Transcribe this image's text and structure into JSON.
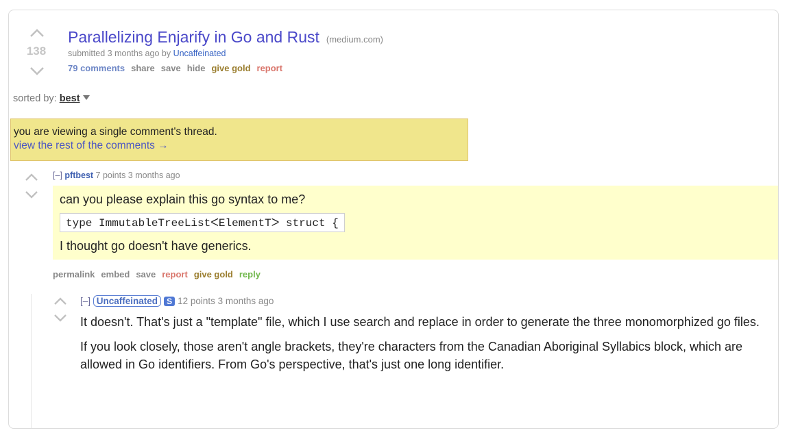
{
  "post": {
    "score": "138",
    "title": "Parallelizing Enjarify in Go and Rust",
    "domain": "(medium.com)",
    "tagline_prefix": "submitted 3 months ago by",
    "author": "Uncaffeinated",
    "buttons": {
      "comments": "79 comments",
      "share": "share",
      "save": "save",
      "hide": "hide",
      "give_gold": "give gold",
      "report": "report"
    }
  },
  "sort": {
    "label": "sorted by:",
    "value": "best"
  },
  "infobar": {
    "line1": "you are viewing a single comment's thread.",
    "line2": "view the rest of the comments →"
  },
  "comment1": {
    "expand": "[–]",
    "author": "pftbest",
    "meta": "7 points 3 months ago",
    "para1": "can you please explain this go syntax to me?",
    "code": "type ImmutableTreeListᐸElementTᐳ struct {",
    "para2": "I thought go doesn't have generics.",
    "buttons": {
      "permalink": "permalink",
      "embed": "embed",
      "save": "save",
      "report": "report",
      "give_gold": "give gold",
      "reply": "reply"
    }
  },
  "comment2": {
    "expand": "[–]",
    "author": "Uncaffeinated",
    "submitter_badge": "S",
    "meta": "12 points 3 months ago",
    "para1": "It doesn't. That's just a \"template\" file, which I use search and replace in order to generate the three monomorphized go files.",
    "para2": "If you look closely, those aren't angle brackets, they're characters from the Canadian Aboriginal Syllabics block, which are allowed in Go identifiers. From Go's perspective, that's just one long identifier."
  },
  "colors": {
    "title_link": "#4a48c9",
    "infobar_bg": "#f0e68c",
    "highlight_bg": "#ffffcc",
    "report": "#d9756b",
    "reply": "#72b84e",
    "give_gold": "#9a7d2e"
  },
  "icons": [
    "upvote-arrow-icon",
    "downvote-arrow-icon",
    "dropdown-triangle-icon"
  ]
}
